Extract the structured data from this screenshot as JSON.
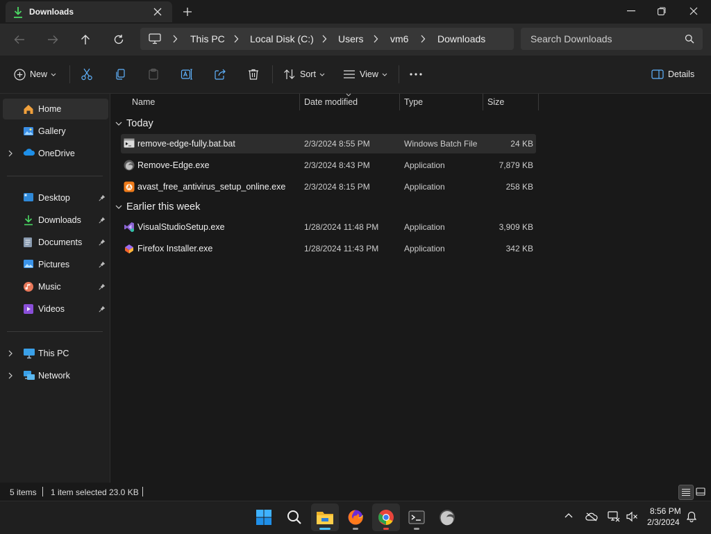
{
  "window": {
    "tab_title": "Downloads",
    "tab_icon": "download-icon"
  },
  "navigation": {
    "breadcrumbs": [
      "This PC",
      "Local Disk (C:)",
      "Users",
      "vm6",
      "Downloads"
    ],
    "search_placeholder": "Search Downloads"
  },
  "toolbar": {
    "new_label": "New",
    "sort_label": "Sort",
    "view_label": "View",
    "details_label": "Details",
    "icons": [
      "cut-icon",
      "copy-icon",
      "paste-icon",
      "rename-icon",
      "share-icon",
      "delete-icon"
    ]
  },
  "sidebar": {
    "items": [
      {
        "label": "Home",
        "icon": "home-icon",
        "selected": true
      },
      {
        "label": "Gallery",
        "icon": "gallery-icon"
      },
      {
        "label": "OneDrive",
        "icon": "onedrive-icon",
        "expandable": true
      },
      {
        "label": "Desktop",
        "icon": "desktop-icon",
        "pinned": true
      },
      {
        "label": "Downloads",
        "icon": "download-icon",
        "pinned": true
      },
      {
        "label": "Documents",
        "icon": "documents-icon",
        "pinned": true
      },
      {
        "label": "Pictures",
        "icon": "pictures-icon",
        "pinned": true
      },
      {
        "label": "Music",
        "icon": "music-icon",
        "pinned": true
      },
      {
        "label": "Videos",
        "icon": "videos-icon",
        "pinned": true
      },
      {
        "label": "This PC",
        "icon": "this-pc-icon",
        "expandable": true
      },
      {
        "label": "Network",
        "icon": "network-icon",
        "expandable": true
      }
    ]
  },
  "file_list": {
    "columns": [
      "Name",
      "Date modified",
      "Type",
      "Size"
    ],
    "groups": [
      {
        "title": "Today",
        "files": [
          {
            "name": "remove-edge-fully.bat.bat",
            "date": "2/3/2024 8:55 PM",
            "type": "Windows Batch File",
            "size": "24 KB",
            "icon": "batch-file-icon",
            "selected": true
          },
          {
            "name": "Remove-Edge.exe",
            "date": "2/3/2024 8:43 PM",
            "type": "Application",
            "size": "7,879 KB",
            "icon": "edge-app-icon"
          },
          {
            "name": "avast_free_antivirus_setup_online.exe",
            "date": "2/3/2024 8:15 PM",
            "type": "Application",
            "size": "258 KB",
            "icon": "avast-icon"
          }
        ]
      },
      {
        "title": "Earlier this week",
        "files": [
          {
            "name": "VisualStudioSetup.exe",
            "date": "1/28/2024 11:48 PM",
            "type": "Application",
            "size": "3,909 KB",
            "icon": "visual-studio-icon"
          },
          {
            "name": "Firefox Installer.exe",
            "date": "1/28/2024 11:43 PM",
            "type": "Application",
            "size": "342 KB",
            "icon": "firefox-installer-icon"
          }
        ]
      }
    ]
  },
  "status": {
    "item_count": "5 items",
    "selection": "1 item selected",
    "selection_size": "23.0 KB"
  },
  "taskbar": {
    "apps": [
      "start-icon",
      "search-icon",
      "file-explorer-icon",
      "firefox-icon",
      "chrome-icon",
      "terminal-icon",
      "edge-icon"
    ],
    "time": "8:56 PM",
    "date": "2/3/2024"
  },
  "colors": {
    "accent": "#4cc2ff",
    "background": "#191919",
    "sidebar": "#202020",
    "selection": "#2d2d2d"
  }
}
